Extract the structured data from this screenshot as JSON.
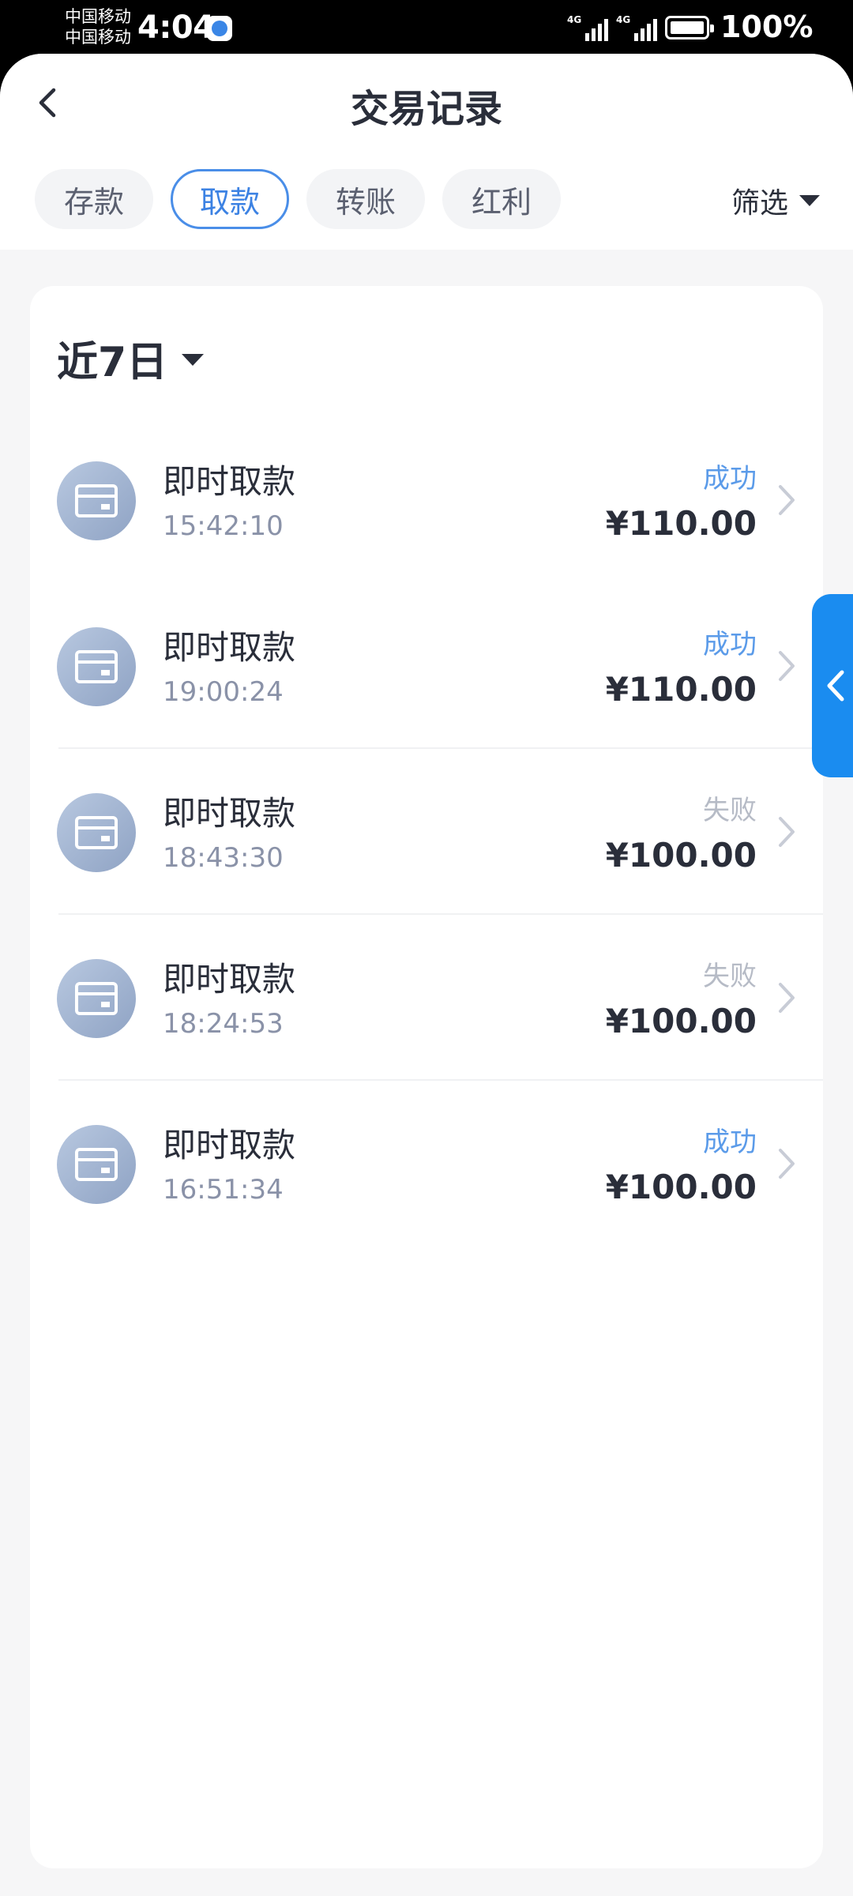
{
  "status_bar": {
    "carrier_1": "中国移动",
    "carrier_2": "中国移动",
    "time": "4:04",
    "network_1": "4G",
    "network_2": "4G",
    "battery": "100%"
  },
  "header": {
    "title": "交易记录",
    "back_icon": "chevron-left-icon"
  },
  "tabs": [
    {
      "label": "存款",
      "active": false
    },
    {
      "label": "取款",
      "active": true
    },
    {
      "label": "转账",
      "active": false
    },
    {
      "label": "红利",
      "active": false
    }
  ],
  "filter": {
    "label": "筛选",
    "icon": "caret-down-icon"
  },
  "period": {
    "label": "近7日",
    "icon": "caret-down-icon"
  },
  "transactions": [
    {
      "title": "即时取款",
      "time": "15:42:10",
      "status": "成功",
      "status_type": "success",
      "amount": "¥110.00"
    },
    {
      "title": "即时取款",
      "time": "19:00:24",
      "status": "成功",
      "status_type": "success",
      "amount": "¥110.00"
    },
    {
      "title": "即时取款",
      "time": "18:43:30",
      "status": "失败",
      "status_type": "fail",
      "amount": "¥100.00"
    },
    {
      "title": "即时取款",
      "time": "18:24:53",
      "status": "失败",
      "status_type": "fail",
      "amount": "¥100.00"
    },
    {
      "title": "即时取款",
      "time": "16:51:34",
      "status": "成功",
      "status_type": "success",
      "amount": "¥100.00"
    }
  ],
  "colors": {
    "accent": "#3c82e3",
    "success": "#5b9be9",
    "fail": "#b6bbc6",
    "side_tab": "#1a8cf0"
  }
}
